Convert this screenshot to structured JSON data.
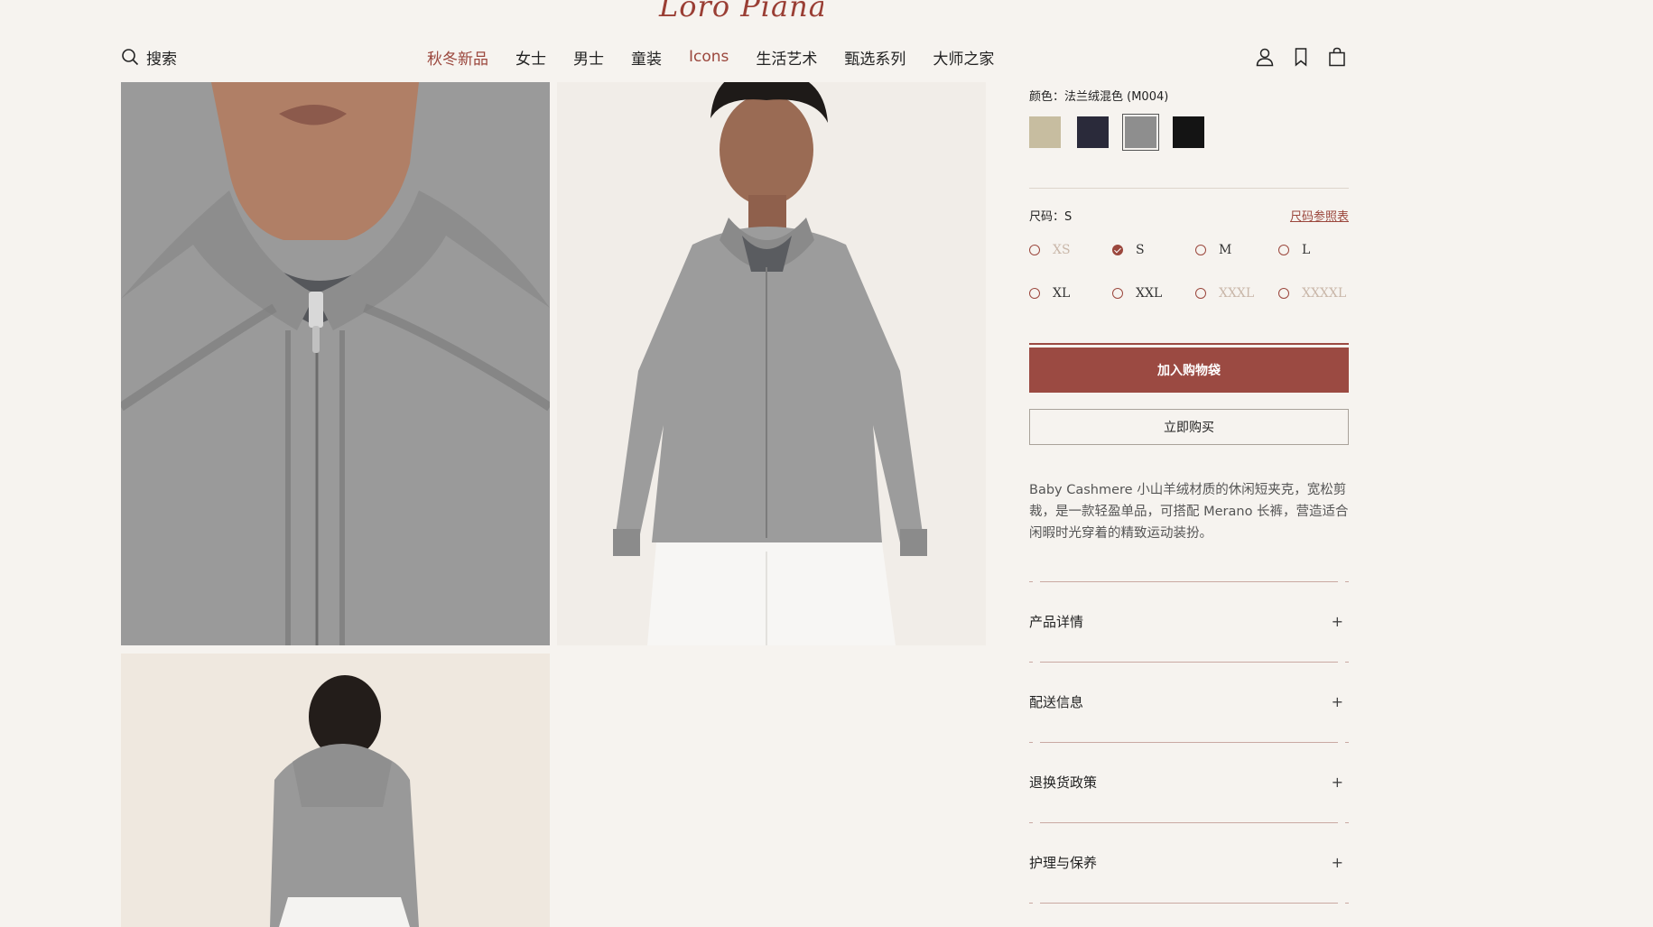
{
  "brand": {
    "name": "Loro Piana"
  },
  "header": {
    "search_label": "搜索",
    "nav": [
      {
        "label": "秋冬新品",
        "accent": true
      },
      {
        "label": "女士",
        "accent": false
      },
      {
        "label": "男士",
        "accent": false
      },
      {
        "label": "童装",
        "accent": false
      },
      {
        "label": "Icons",
        "accent": true
      },
      {
        "label": "生活艺术",
        "accent": false
      },
      {
        "label": "甄选系列",
        "accent": false
      },
      {
        "label": "大师之家",
        "accent": false
      }
    ],
    "tools": [
      "account-icon",
      "bookmark-icon",
      "shopping-bag-icon"
    ]
  },
  "gallery": [
    {
      "name": "hoodie-closeup",
      "alt": ""
    },
    {
      "name": "hoodie-front",
      "alt": ""
    },
    {
      "name": "hoodie-back",
      "alt": ""
    }
  ],
  "product": {
    "color_label": "颜色：法兰绒混色 (M004)",
    "swatches": [
      {
        "color": "#c7bda0",
        "selected": false
      },
      {
        "color": "#2a2a3a",
        "selected": false
      },
      {
        "color": "#8e8e8e",
        "selected": true
      },
      {
        "color": "#141414",
        "selected": false
      }
    ],
    "size_label": "尺码：S",
    "size_guide": "尺码参照表",
    "sizes": [
      {
        "label": "XS",
        "available": false,
        "selected": false
      },
      {
        "label": "S",
        "available": true,
        "selected": true
      },
      {
        "label": "M",
        "available": true,
        "selected": false
      },
      {
        "label": "L",
        "available": true,
        "selected": false
      },
      {
        "label": "XL",
        "available": true,
        "selected": false
      },
      {
        "label": "XXL",
        "available": true,
        "selected": false
      },
      {
        "label": "XXXL",
        "available": false,
        "selected": false
      },
      {
        "label": "XXXXL",
        "available": false,
        "selected": false
      }
    ],
    "add_to_bag": "加入购物袋",
    "buy_now": "立即购买",
    "description": "Baby Cashmere 小山羊绒材质的休闲短夹克，宽松剪裁，是一款轻盈单品，可搭配 Merano 长裤，营造适合闲暇时光穿着的精致运动装扮。",
    "accordion": [
      {
        "title": "产品详情",
        "toggle": "+"
      },
      {
        "title": "配送信息",
        "toggle": "+"
      },
      {
        "title": "退换货政策",
        "toggle": "+"
      },
      {
        "title": "护理与保养",
        "toggle": "+"
      }
    ]
  },
  "colors": {
    "accent": "#9b473d",
    "background": "#f6f3ef"
  }
}
